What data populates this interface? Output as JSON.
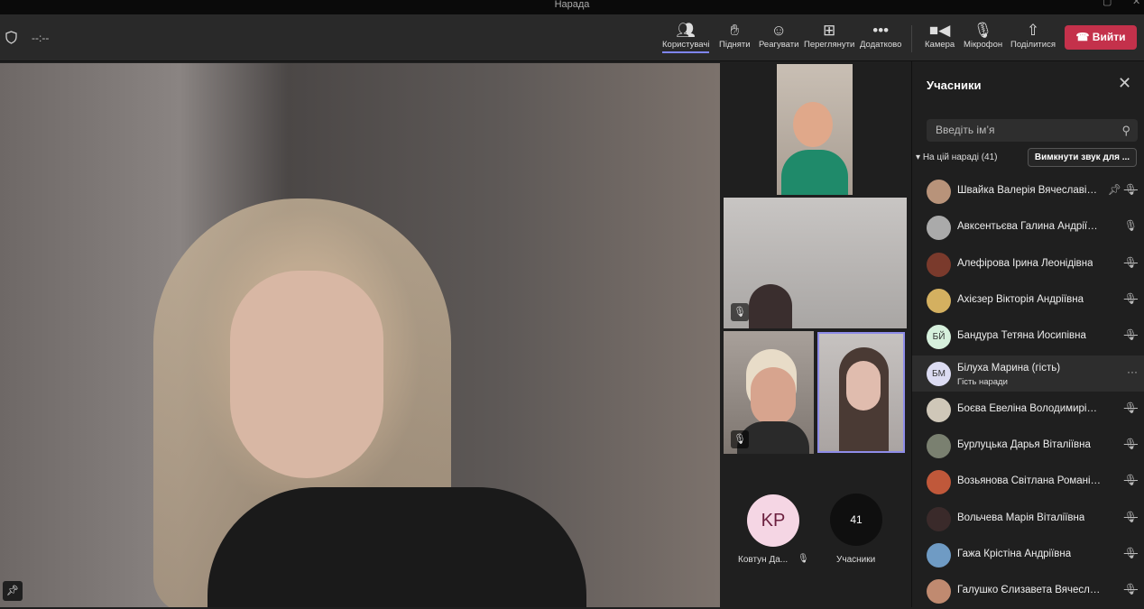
{
  "window": {
    "title": "Нарада"
  },
  "toolbar": {
    "timer": "--:--",
    "buttons": [
      {
        "label": "Користувачі",
        "icon": "people-icon"
      },
      {
        "label": "Підняти",
        "icon": "hand-icon"
      },
      {
        "label": "Реагувати",
        "icon": "smile-icon"
      },
      {
        "label": "Переглянути",
        "icon": "grid-icon"
      },
      {
        "label": "Додатково",
        "icon": "more-icon"
      },
      {
        "label": "Камера",
        "icon": "camera-icon"
      },
      {
        "label": "Мікрофон",
        "icon": "mic-off-icon"
      },
      {
        "label": "Поділитися",
        "icon": "share-icon"
      }
    ],
    "leave": "Вийти"
  },
  "gallery": {
    "avatar_initials": "KP",
    "avatar_name": "Ковтун Да...",
    "count": "41",
    "count_label": "Учасники"
  },
  "panel": {
    "title": "Учасники",
    "search_placeholder": "Введіть ім’я",
    "section": "На цій нараді (41)",
    "mute_all": "Вимкнути звук для ...",
    "participants": [
      {
        "name": "Швайка Валерія Вячеславівна",
        "color": "#b8937a",
        "status": "muted",
        "pinned": true
      },
      {
        "name": "Авксентьєва Галина Андріївна",
        "color": "#aaa",
        "status": "mic"
      },
      {
        "name": "Алефірова Ірина Леонідівна",
        "color": "#7a3a2c",
        "status": "muted"
      },
      {
        "name": "Ахієзер Вікторія Андріївна",
        "color": "#d4b060",
        "status": "muted"
      },
      {
        "name": "Бандура Тетяна Йосипівна",
        "initials": "БЙ",
        "color": "#d6f0dc",
        "status": "muted"
      },
      {
        "name": "Білуха Марина (гість)",
        "sub": "Гість наради",
        "initials": "БМ",
        "color": "#dcdcf2",
        "status": "more"
      },
      {
        "name": "Боєва Евеліна Володимирівна",
        "color": "#cfc7b8",
        "status": "muted"
      },
      {
        "name": "Бурлуцька Дарья Віталіївна",
        "color": "#7a8070",
        "status": "muted"
      },
      {
        "name": "Возьянова Світлана Романівна",
        "color": "#c0583a",
        "status": "muted"
      },
      {
        "name": "Вольчева Марія Віталіївна",
        "color": "#3a2a2a",
        "status": "muted"
      },
      {
        "name": "Гажа Крістіна Андріївна",
        "color": "#6f9bc4",
        "status": "muted"
      },
      {
        "name": "Галушко Єлизавета Вячеславівна",
        "color": "#c08a70",
        "status": "muted"
      }
    ]
  }
}
